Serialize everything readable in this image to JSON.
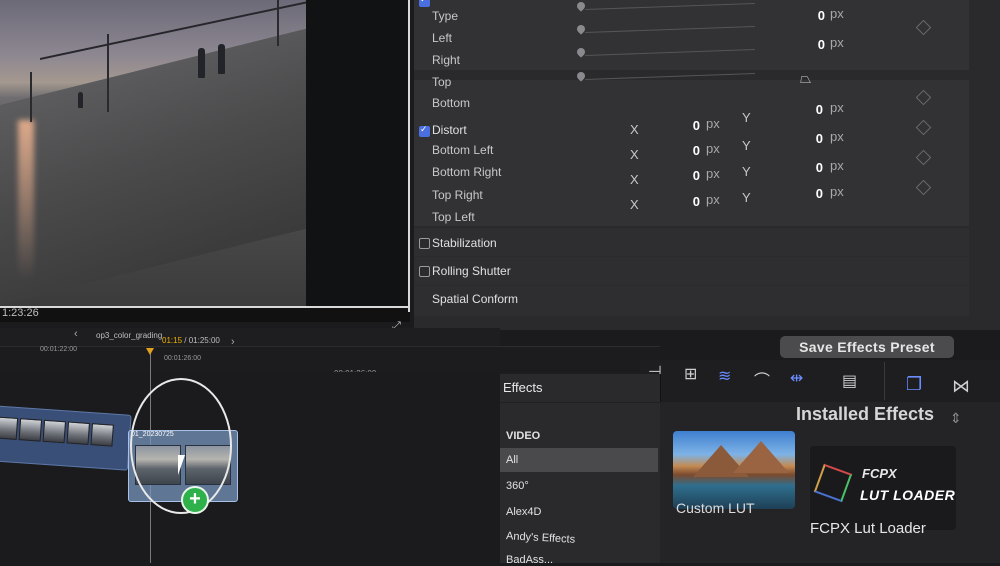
{
  "viewer": {
    "timecode": "1:23:26"
  },
  "inspector": {
    "crop_rows": [
      {
        "label": "Type",
        "value": "0",
        "unit": "px"
      },
      {
        "label": "Left",
        "value": "0",
        "unit": "px"
      },
      {
        "label": "Right"
      },
      {
        "label": "Top"
      },
      {
        "label": "Bottom"
      }
    ],
    "distort": {
      "title": "Distort",
      "checked": true,
      "rows": [
        {
          "label": "Bottom Left",
          "x_label": "X",
          "x_value": "0",
          "x_unit": "px",
          "y_label": "Y",
          "y_value": "0",
          "y_unit": "px"
        },
        {
          "label": "Bottom Right",
          "x_label": "X",
          "x_value": "0",
          "x_unit": "px",
          "y_label": "Y",
          "y_value": "0",
          "y_unit": "px"
        },
        {
          "label": "Top Right",
          "x_label": "X",
          "x_value": "0",
          "x_unit": "px",
          "y_label": "Y",
          "y_value": "0",
          "y_unit": "px"
        },
        {
          "label": "Top Left",
          "x_label": "X",
          "x_value": "0",
          "x_unit": "px",
          "y_label": "Y",
          "y_value": "0",
          "y_unit": "px"
        }
      ]
    },
    "stabilization": "Stabilization",
    "rolling_shutter": "Rolling Shutter",
    "spatial_conform": "Spatial Conform",
    "save_preset": "Save Effects Preset"
  },
  "timeline": {
    "project_name": "op3_color_grading",
    "time_current": "01:15",
    "time_total": " / 01:25:00",
    "ruler_ticks": [
      "00:01:22:00",
      "00:01:26:00",
      "00:01:26:00"
    ],
    "prev_icon": "chevron-left-icon",
    "next_icon": "chevron-right-icon",
    "drag_clip_label": "01_20230725"
  },
  "toolbar": {
    "icons": [
      "insert-icon",
      "append-icon",
      "audio-waveform-icon",
      "headphones-icon",
      "clip-skimming-icon",
      "filmstrip-icon",
      "effects-browser-icon",
      "transitions-icon"
    ],
    "accent": "#6b8cff"
  },
  "effects": {
    "title": "Effects",
    "categories": [
      "VIDEO",
      "All",
      "360°",
      "Alex4D",
      "Andy's Effects",
      "BadAss..."
    ],
    "selected": "All",
    "installed_label": "Installed Effects",
    "items": [
      {
        "name": "Custom LUT"
      },
      {
        "name": "FCPX Lut Loader",
        "thumb_line1": "FCPX",
        "thumb_line2": "LUT LOADER"
      }
    ]
  },
  "colors": {
    "accent_blue": "#4a6fe0",
    "playhead_marker": "#e2a020",
    "add_badge": "#2eb04a"
  }
}
